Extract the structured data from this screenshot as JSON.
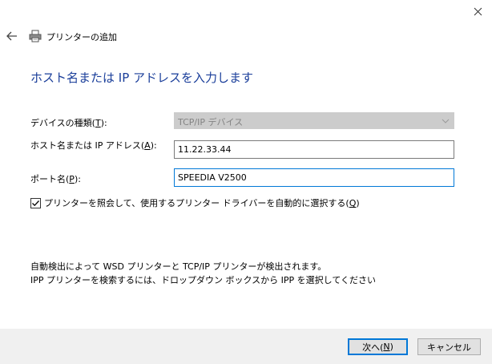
{
  "window": {
    "title": "プリンターの追加",
    "close_icon": "close-icon",
    "back_icon": "back-arrow-icon",
    "printer_icon": "printer-icon"
  },
  "heading": "ホスト名または IP アドレスを入力します",
  "device_type": {
    "label_pre": "デバイスの種類(",
    "label_key": "T",
    "label_post": "):",
    "value": "TCP/IP デバイス"
  },
  "host": {
    "label_pre": "ホスト名または IP アドレス(",
    "label_key": "A",
    "label_post": "):",
    "value": "11.22.33.44"
  },
  "port": {
    "label_pre": "ポート名(",
    "label_key": "P",
    "label_post": "):",
    "value": "SPEEDIA V2500"
  },
  "query_printer": {
    "checked": true,
    "label_pre": "プリンターを照会して、使用するプリンター ドライバーを自動的に選択する(",
    "label_key": "Q",
    "label_post": ")"
  },
  "info": {
    "line1": "自動検出によって WSD プリンターと TCP/IP プリンターが検出されます。",
    "line2": "IPP プリンターを検索するには、ドロップダウン ボックスから IPP を選択してください"
  },
  "buttons": {
    "next_pre": "次へ(",
    "next_key": "N",
    "next_post": ")",
    "cancel": "キャンセル"
  },
  "colors": {
    "heading": "#1a3e9a",
    "focus_border": "#0078d7",
    "footer_bg": "#f0f0f0",
    "disabled_bg": "#cccccc"
  }
}
